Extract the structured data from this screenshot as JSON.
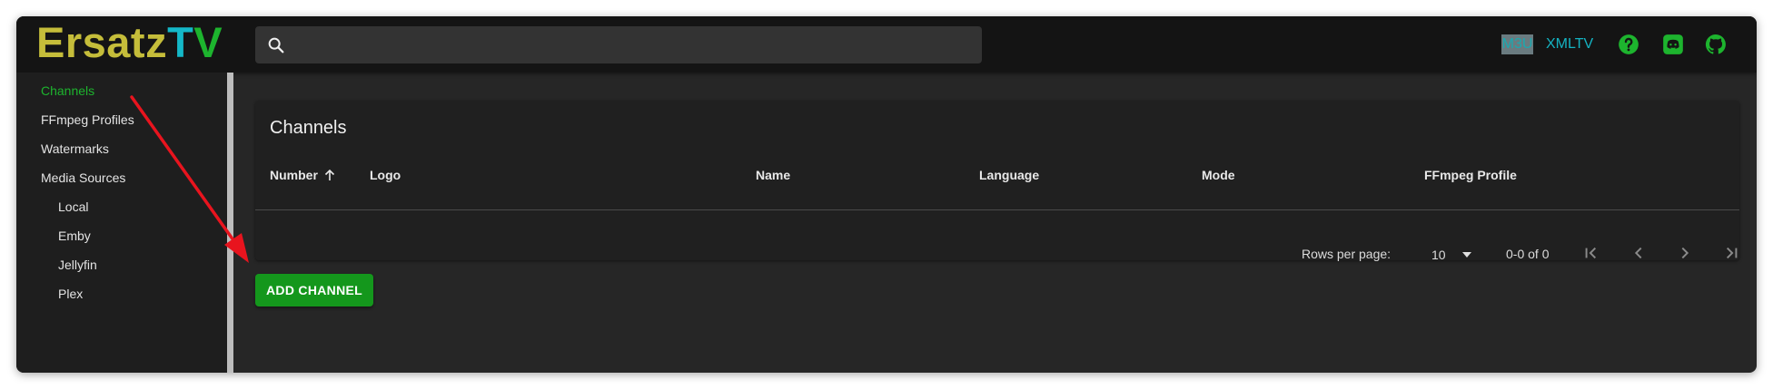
{
  "app": {
    "logo_part1": "Ersatz",
    "logo_part2": "T",
    "logo_part3": "V"
  },
  "search": {
    "placeholder": "",
    "value": ""
  },
  "header_links": {
    "m3u": "M3U",
    "xmltv": "XMLTV"
  },
  "sidebar": {
    "items": [
      {
        "label": "Channels"
      },
      {
        "label": "FFmpeg Profiles"
      },
      {
        "label": "Watermarks"
      },
      {
        "label": "Media Sources"
      },
      {
        "label": "Local"
      },
      {
        "label": "Emby"
      },
      {
        "label": "Jellyfin"
      },
      {
        "label": "Plex"
      }
    ]
  },
  "card": {
    "title": "Channels",
    "columns": [
      "Number",
      "Logo",
      "Name",
      "Language",
      "Mode",
      "FFmpeg Profile"
    ],
    "rows_per_page_label": "Rows per page:",
    "rows_per_page_value": "10",
    "range_text": "0-0 of 0"
  },
  "add_button": {
    "label": "ADD CHANNEL"
  },
  "colors": {
    "accent_green": "#1db42e",
    "accent_teal": "#14b8c8",
    "logo_yellow": "#c5bd3a",
    "button_green": "#14971c",
    "annotation_red": "#e8141e"
  },
  "icons": [
    "search-icon",
    "help-icon",
    "discord-icon",
    "github-icon",
    "sort-ascending-icon",
    "dropdown-arrow-icon",
    "first-page-icon",
    "previous-page-icon",
    "next-page-icon",
    "last-page-icon"
  ]
}
